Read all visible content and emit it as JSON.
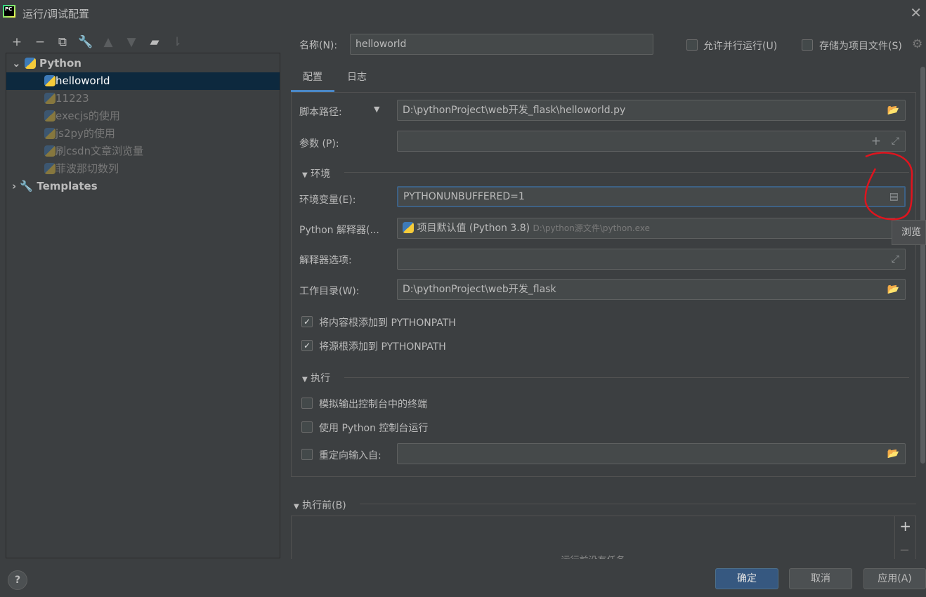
{
  "window": {
    "title": "运行/调试配置",
    "close_icon": "close-icon",
    "logo_text": "PC"
  },
  "toolbar": {
    "icons": [
      "add-icon",
      "remove-icon",
      "copy-icon",
      "wrench-icon",
      "move-up-icon",
      "move-down-icon",
      "new-folder-icon",
      "sort-icon"
    ]
  },
  "tree": {
    "python_label": "Python",
    "items": [
      "helloworld",
      "11223",
      "execjs的使用",
      "js2py的使用",
      "刷csdn文章浏览量",
      "菲波那切数列"
    ],
    "templates_label": "Templates"
  },
  "header": {
    "name_label": "名称(N):",
    "name_value": "helloworld",
    "parallel_label": "允许并行运行(U)",
    "store_label": "存储为项目文件(S)"
  },
  "tabs": [
    "配置",
    "日志"
  ],
  "form": {
    "script_label": "脚本路径:",
    "script_value": "D:\\pythonProject\\web开发_flask\\helloworld.py",
    "params_label": "参数 (P):",
    "params_value": "",
    "env_section": "环境",
    "envvars_label": "环境变量(E):",
    "envvars_value": "PYTHONUNBUFFERED=1",
    "interpreter_label": "Python 解释器(...",
    "interpreter_value": "项目默认值 (Python 3.8)",
    "interpreter_path": "D:\\python源文件\\python.exe",
    "tooltip": "浏览",
    "interp_opts_label": "解释器选项:",
    "interp_opts_value": "",
    "workdir_label": "工作目录(W):",
    "workdir_value": "D:\\pythonProject\\web开发_flask",
    "add_content_roots": {
      "label": "将内容根添加到 PYTHONPATH",
      "checked": true
    },
    "add_source_roots": {
      "label": "将源根添加到 PYTHONPATH",
      "checked": true
    },
    "exec_section": "执行",
    "emulate_terminal": {
      "label": "模拟输出控制台中的终端",
      "checked": false
    },
    "python_console": {
      "label": "使用 Python 控制台运行",
      "checked": false
    },
    "redirect_input": {
      "label": "重定向输入自:",
      "checked": false,
      "value": ""
    }
  },
  "before_launch": {
    "label": "执行前(B)",
    "empty_text": "运行前没有任务"
  },
  "buttons": {
    "ok": "确定",
    "cancel": "取消",
    "apply": "应用(A)",
    "help": "?"
  },
  "colors": {
    "selection": "#0d293e",
    "focus": "#3d6185",
    "primary": "#365880",
    "annotation": "#e0141e"
  }
}
